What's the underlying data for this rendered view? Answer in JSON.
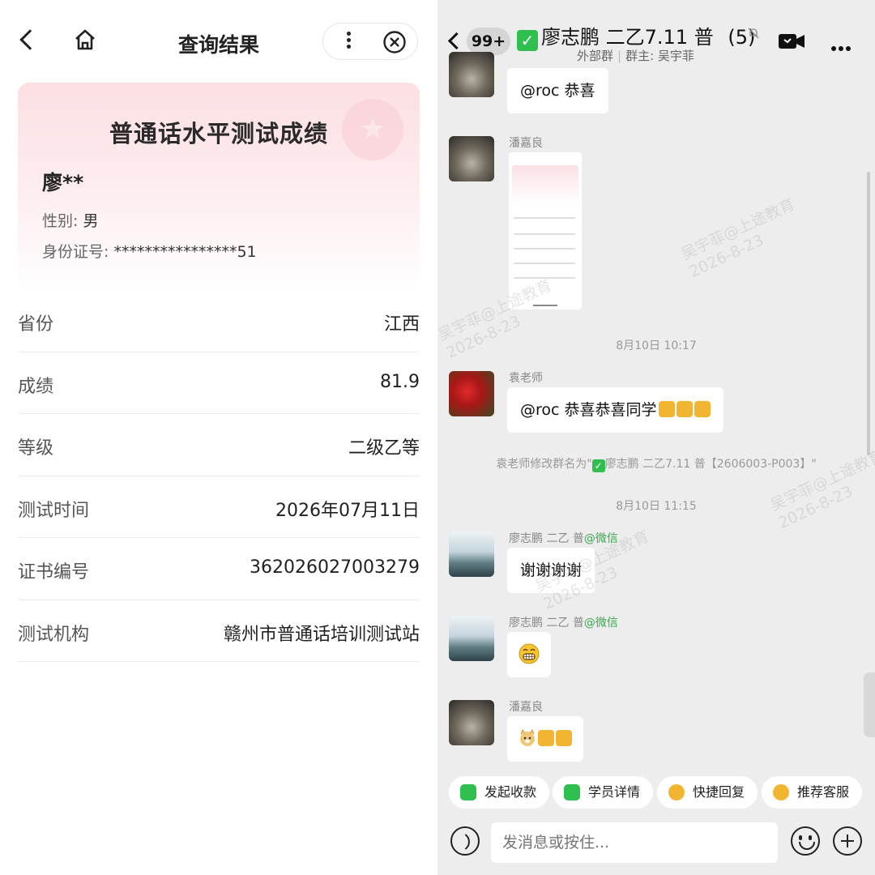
{
  "left": {
    "nav_title": "查询结果",
    "card": {
      "title": "普通话水平测试成绩",
      "name": "廖**",
      "gender_label": "性别:",
      "gender_value": "男",
      "id_label": "身份证号:",
      "id_value": "****************51"
    },
    "rows": [
      {
        "label": "省份",
        "value": "江西"
      },
      {
        "label": "成绩",
        "value": "81.9"
      },
      {
        "label": "等级",
        "value": "二级乙等"
      },
      {
        "label": "测试时间",
        "value": "2026年07月11日"
      },
      {
        "label": "证书编号",
        "value": "362026027003279"
      },
      {
        "label": "测试机构",
        "value": "赣州市普通话培训测试站"
      }
    ]
  },
  "right": {
    "badge": "99+",
    "group_title": "廖志鹏 二乙7.11 普",
    "member_count": "(5)",
    "subtitle_a": "外部群",
    "subtitle_b": "群主: 吴宇菲",
    "messages": {
      "m1_text": "@roc 恭喜",
      "m2_sender": "潘嘉良",
      "ts1": "8月10日 10:17",
      "m3_sender": "袁老师",
      "m3_text": "@roc 恭喜恭喜同学",
      "sys_prefix": "袁老师修改群名为\"",
      "sys_suffix": "廖志鹏 二乙7.11 普【2606003-P003】\"",
      "ts2": "8月10日 11:15",
      "m4_sender": "廖志鹏 二乙 普",
      "m4_suffix": "@微信",
      "m4_text": "谢谢谢谢",
      "m5_sender": "廖志鹏 二乙 普",
      "m5_suffix": "@微信",
      "m6_sender": "潘嘉良"
    },
    "quick_actions": [
      {
        "label": "发起收款",
        "icon": "yuan-icon"
      },
      {
        "label": "学员详情",
        "icon": "user-icon"
      },
      {
        "label": "快捷回复",
        "icon": "reply-icon"
      },
      {
        "label": "推荐客服",
        "icon": "service-icon"
      }
    ],
    "input_placeholder": "发消息或按住...",
    "watermark": [
      "吴宇菲@上途教育",
      "2026-8-23"
    ],
    "accent_green": "#2fbf4f"
  }
}
